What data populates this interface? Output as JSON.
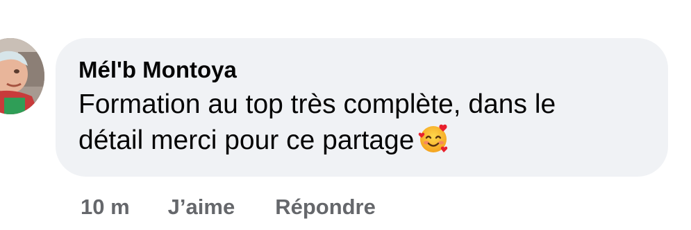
{
  "comment": {
    "author": "Mél'b Montoya",
    "line1": "Formation au top très complète, dans le",
    "line2": "détail merci pour ce partage",
    "emoji": "smiling-face-with-hearts-icon"
  },
  "actions": {
    "time": "10 m",
    "like_label": "J’aime",
    "reply_label": "Répondre"
  },
  "colors": {
    "bubble": "#f0f2f5",
    "text": "#050505",
    "secondary": "#65676b"
  }
}
